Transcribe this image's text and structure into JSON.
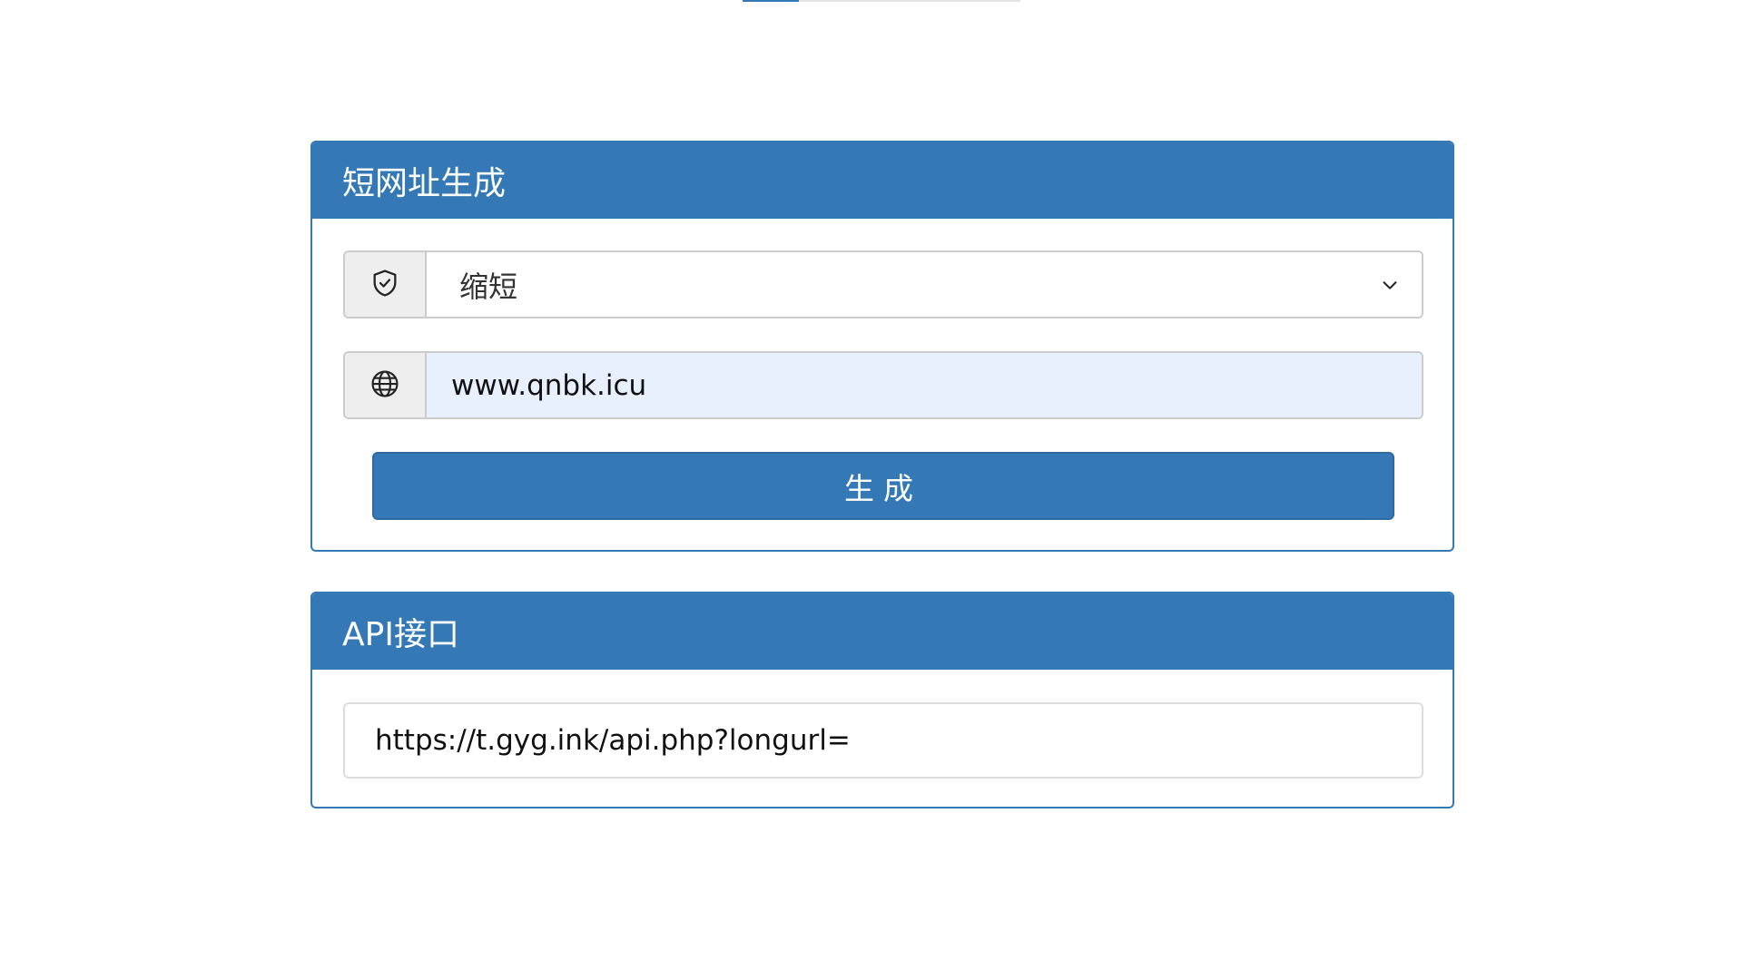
{
  "shortener": {
    "title": "短网址生成",
    "mode": {
      "icon": "shield-check-icon",
      "selected": "缩短"
    },
    "url": {
      "icon": "globe-icon",
      "value": "www.qnbk.icu"
    },
    "generate_label": "生成"
  },
  "api": {
    "title": "API接口",
    "endpoint": "https://t.gyg.ink/api.php?longurl="
  },
  "colors": {
    "primary": "#3479b5",
    "autofill": "#e8f0fe",
    "addon": "#eeeeee"
  }
}
